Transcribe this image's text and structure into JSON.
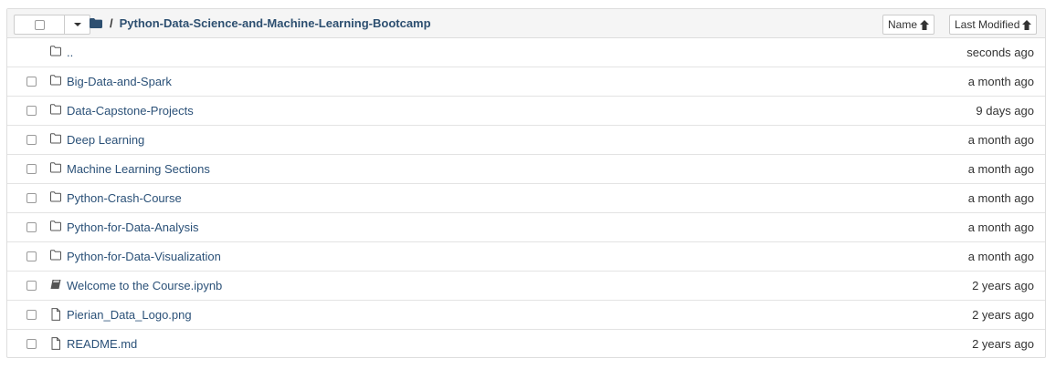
{
  "header": {
    "breadcrumb_sep": "/",
    "path": "Python-Data-Science-and-Machine-Learning-Bootcamp",
    "sort_name_label": "Name",
    "sort_modified_label": "Last Modified"
  },
  "rows": [
    {
      "name": "..",
      "time": "seconds ago",
      "icon": "folder-icon",
      "checkbox": false
    },
    {
      "name": "Big-Data-and-Spark",
      "time": "a month ago",
      "icon": "folder-icon",
      "checkbox": true
    },
    {
      "name": "Data-Capstone-Projects",
      "time": "9 days ago",
      "icon": "folder-icon",
      "checkbox": true
    },
    {
      "name": "Deep Learning",
      "time": "a month ago",
      "icon": "folder-icon",
      "checkbox": true
    },
    {
      "name": "Machine Learning Sections",
      "time": "a month ago",
      "icon": "folder-icon",
      "checkbox": true
    },
    {
      "name": "Python-Crash-Course",
      "time": "a month ago",
      "icon": "folder-icon",
      "checkbox": true
    },
    {
      "name": "Python-for-Data-Analysis",
      "time": "a month ago",
      "icon": "folder-icon",
      "checkbox": true
    },
    {
      "name": "Python-for-Data-Visualization",
      "time": "a month ago",
      "icon": "folder-icon",
      "checkbox": true
    },
    {
      "name": "Welcome to the Course.ipynb",
      "time": "2 years ago",
      "icon": "notebook-icon",
      "checkbox": true
    },
    {
      "name": "Pierian_Data_Logo.png",
      "time": "2 years ago",
      "icon": "file-icon",
      "checkbox": true
    },
    {
      "name": "README.md",
      "time": "2 years ago",
      "icon": "file-icon",
      "checkbox": true
    }
  ],
  "colors": {
    "link": "#2b5178",
    "header_bg": "#f5f5f5",
    "border": "#dddddd"
  }
}
